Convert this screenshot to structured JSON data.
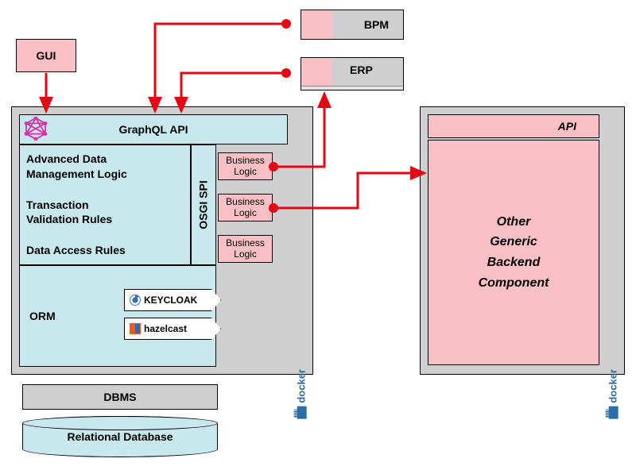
{
  "gui": {
    "label": "GUI"
  },
  "bpm": {
    "label": "BPM"
  },
  "erp": {
    "label": "ERP"
  },
  "graphql": {
    "label": "GraphQL API",
    "logo": "graphql-icon"
  },
  "advanced": {
    "l1": "Advanced Data",
    "l2": "Management Logic",
    "l3": "Transaction",
    "l4": "Validation Rules",
    "l5": "Data Access Rules"
  },
  "osgi": {
    "label": "OSGI SPI"
  },
  "business_logic": {
    "label": "Business\nLogic"
  },
  "orm": {
    "label": "ORM"
  },
  "tags": {
    "keycloak": "KEYCLOAK",
    "hazelcast": "hazelcast"
  },
  "docker": {
    "label": "docker"
  },
  "dbms": {
    "label": "DBMS"
  },
  "reldb": {
    "label": "Relational Database"
  },
  "api": {
    "label": "API"
  },
  "other": {
    "l1": "Other",
    "l2": "Generic",
    "l3": "Backend",
    "l4": "Component"
  }
}
